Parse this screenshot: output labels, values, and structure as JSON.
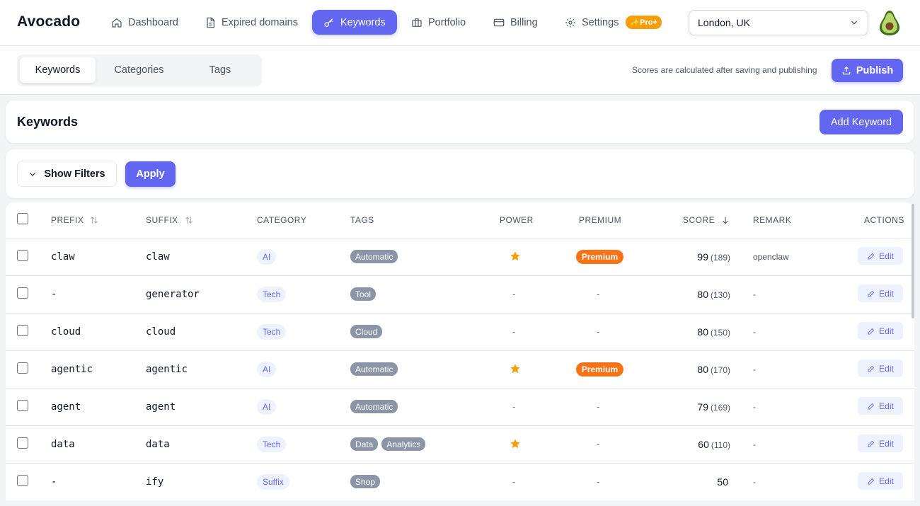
{
  "app": {
    "brand": "Avocado"
  },
  "nav": {
    "items": [
      {
        "id": "dashboard",
        "label": "Dashboard",
        "icon": "home-icon"
      },
      {
        "id": "expired",
        "label": "Expired domains",
        "icon": "document-icon"
      },
      {
        "id": "keywords",
        "label": "Keywords",
        "icon": "key-icon",
        "active": true
      },
      {
        "id": "portfolio",
        "label": "Portfolio",
        "icon": "briefcase-icon"
      },
      {
        "id": "billing",
        "label": "Billing",
        "icon": "credit-card-icon"
      },
      {
        "id": "settings",
        "label": "Settings",
        "icon": "gear-icon"
      }
    ],
    "pro_badge": "Pro+",
    "location": "London, UK"
  },
  "subbar": {
    "tabs": [
      "Keywords",
      "Categories",
      "Tags"
    ],
    "active_tab": "Keywords",
    "note": "Scores are calculated after saving and publishing",
    "publish_label": "Publish"
  },
  "keywords_card": {
    "title": "Keywords",
    "add_label": "Add Keyword"
  },
  "filters": {
    "show_label": "Show Filters",
    "apply_label": "Apply"
  },
  "table": {
    "headers": {
      "prefix": "PREFIX",
      "suffix": "SUFFIX",
      "category": "CATEGORY",
      "tags": "TAGS",
      "power": "POWER",
      "premium": "PREMIUM",
      "score": "SCORE",
      "remark": "REMARK",
      "actions": "ACTIONS"
    },
    "edit_label": "Edit",
    "premium_label": "Premium",
    "empty": "-",
    "rows": [
      {
        "prefix": "claw",
        "suffix": "claw",
        "category": "AI",
        "tags": [
          "Automatic"
        ],
        "power": true,
        "premium": true,
        "score": "99",
        "count": "(189)",
        "remark": "openclaw"
      },
      {
        "prefix": "-",
        "suffix": "generator",
        "category": "Tech",
        "tags": [
          "Tool"
        ],
        "power": false,
        "premium": false,
        "score": "80",
        "count": "(130)",
        "remark": "-"
      },
      {
        "prefix": "cloud",
        "suffix": "cloud",
        "category": "Tech",
        "tags": [
          "Cloud"
        ],
        "power": false,
        "premium": false,
        "score": "80",
        "count": "(150)",
        "remark": "-"
      },
      {
        "prefix": "agentic",
        "suffix": "agentic",
        "category": "AI",
        "tags": [
          "Automatic"
        ],
        "power": true,
        "premium": true,
        "score": "80",
        "count": "(170)",
        "remark": "-"
      },
      {
        "prefix": "agent",
        "suffix": "agent",
        "category": "AI",
        "tags": [
          "Automatic"
        ],
        "power": false,
        "premium": false,
        "score": "79",
        "count": "(169)",
        "remark": "-"
      },
      {
        "prefix": "data",
        "suffix": "data",
        "category": "Tech",
        "tags": [
          "Data",
          "Analytics"
        ],
        "power": true,
        "premium": false,
        "score": "60",
        "count": "(110)",
        "remark": "-"
      },
      {
        "prefix": "-",
        "suffix": "ify",
        "category": "Suffix",
        "tags": [
          "Shop"
        ],
        "power": false,
        "premium": false,
        "score": "50",
        "count": "",
        "remark": "-"
      }
    ]
  },
  "colors": {
    "accent": "#6366f1",
    "premium": "#f97316",
    "star": "#f59e0b",
    "pro": "#f59e0b"
  }
}
